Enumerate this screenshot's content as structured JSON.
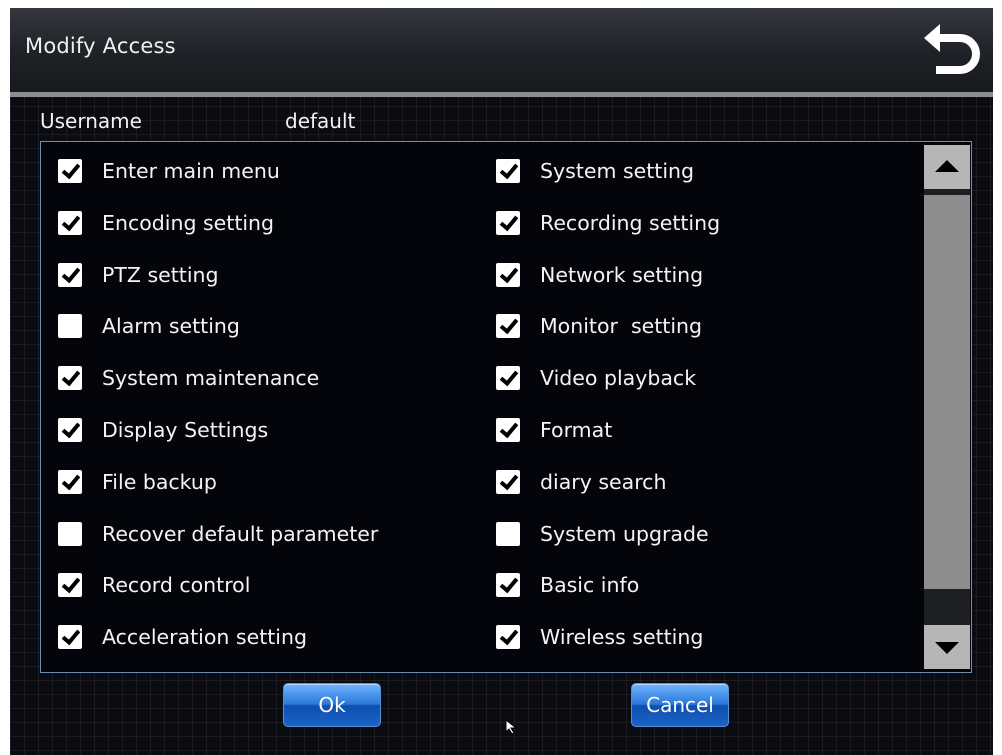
{
  "window": {
    "title": "Modify Access",
    "back_icon": "back-arrow-icon"
  },
  "user": {
    "label": "Username",
    "value": "default"
  },
  "permissions": {
    "left": [
      {
        "label": "Enter main menu",
        "checked": true
      },
      {
        "label": "Encoding setting",
        "checked": true
      },
      {
        "label": "PTZ setting",
        "checked": true
      },
      {
        "label": "Alarm setting",
        "checked": false
      },
      {
        "label": "System maintenance",
        "checked": true
      },
      {
        "label": "Display Settings",
        "checked": true
      },
      {
        "label": "File backup",
        "checked": true
      },
      {
        "label": "Recover default parameter",
        "checked": false
      },
      {
        "label": "Record control",
        "checked": true
      },
      {
        "label": "Acceleration setting",
        "checked": true
      }
    ],
    "right": [
      {
        "label": "System setting",
        "checked": true
      },
      {
        "label": "Recording setting",
        "checked": true
      },
      {
        "label": "Network setting",
        "checked": true
      },
      {
        "label": "Monitor  setting",
        "checked": true
      },
      {
        "label": "Video playback",
        "checked": true
      },
      {
        "label": "Format",
        "checked": true
      },
      {
        "label": "diary search",
        "checked": true
      },
      {
        "label": "System upgrade",
        "checked": false
      },
      {
        "label": "Basic info",
        "checked": true
      },
      {
        "label": "Wireless setting",
        "checked": true
      }
    ]
  },
  "scrollbar": {
    "up_icon": "triangle-up-icon",
    "down_icon": "triangle-down-icon"
  },
  "buttons": {
    "ok": "Ok",
    "cancel": "Cancel"
  },
  "colors": {
    "button_blue": "#2a78d8",
    "panel_border": "#6f8fb0",
    "background": "#0a0c12"
  }
}
